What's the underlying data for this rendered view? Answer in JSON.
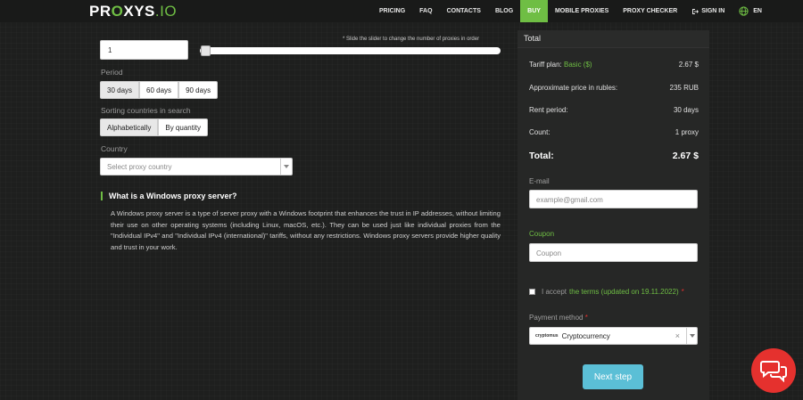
{
  "header": {
    "logo_main": "PR",
    "logo_o": "O",
    "logo_mid": "XYS",
    "logo_tail": ".IO",
    "nav": [
      {
        "label": "PRICING"
      },
      {
        "label": "FAQ"
      },
      {
        "label": "CONTACTS"
      },
      {
        "label": "BLOG"
      },
      {
        "label": "BUY",
        "active": true
      },
      {
        "label": "MOBILE PROXIES"
      },
      {
        "label": "PROXY CHECKER"
      },
      {
        "label": "SIGN IN"
      },
      {
        "label": "EN"
      }
    ]
  },
  "order": {
    "quantity": "1",
    "slider_hint": "* Slide the slider to change the number of proxies in order",
    "slider_value_fraction": 0,
    "period_label": "Period",
    "period_options": [
      "30 days",
      "60 days",
      "90 days"
    ],
    "period_selected": "30 days",
    "sorting_label": "Sorting countries in search",
    "sorting_options": [
      "Alphabetically",
      "By quantity"
    ],
    "sorting_selected": "Alphabetically",
    "country_label": "Country",
    "country_placeholder": "Select proxy country"
  },
  "faq": {
    "title": "What is a Windows proxy server?",
    "body": "A Windows proxy server is a type of server proxy with a Windows footprint that enhances the trust in IP addresses, without limiting their use on other operating systems (including Linux, macOS, etc.). They can be used just like individual proxies from the \"Individual IPv4\" and \"Individual IPv4 (international)\" tariffs, without any restrictions. Windows proxy servers provide higher quality and trust in your work."
  },
  "summary": {
    "header": "Total",
    "tariff_label": "Tariff plan:",
    "tariff_plan": "Basic ($)",
    "tariff_value": "2.67 $",
    "rub_label": "Approximate price in rubles:",
    "rub_value": "235 RUB",
    "period_label": "Rent period:",
    "period_value": "30 days",
    "count_label": "Count:",
    "count_value": "1 proxy",
    "total_label": "Total:",
    "total_value": "2.67 $"
  },
  "form": {
    "email_label": "E-mail",
    "email_placeholder": "example@gmail.com",
    "coupon_label": "Coupon",
    "coupon_placeholder": "Coupon",
    "accept_prefix": "I accept",
    "accept_link": "the terms (updated on 19.11.2022)",
    "accept_star": "*",
    "payment_label": "Payment method",
    "payment_star": "*",
    "payment_logo": "cryptomus",
    "payment_value": "Cryptocurrency",
    "payment_clear": "×",
    "next_label": "Next step"
  },
  "colors": {
    "accent": "#6fbe44",
    "button": "#5bbfd6",
    "chat": "#e5312e"
  },
  "icons": [
    "globe-icon",
    "sign-in-icon",
    "chat-icon",
    "dropdown-caret-icon"
  ]
}
